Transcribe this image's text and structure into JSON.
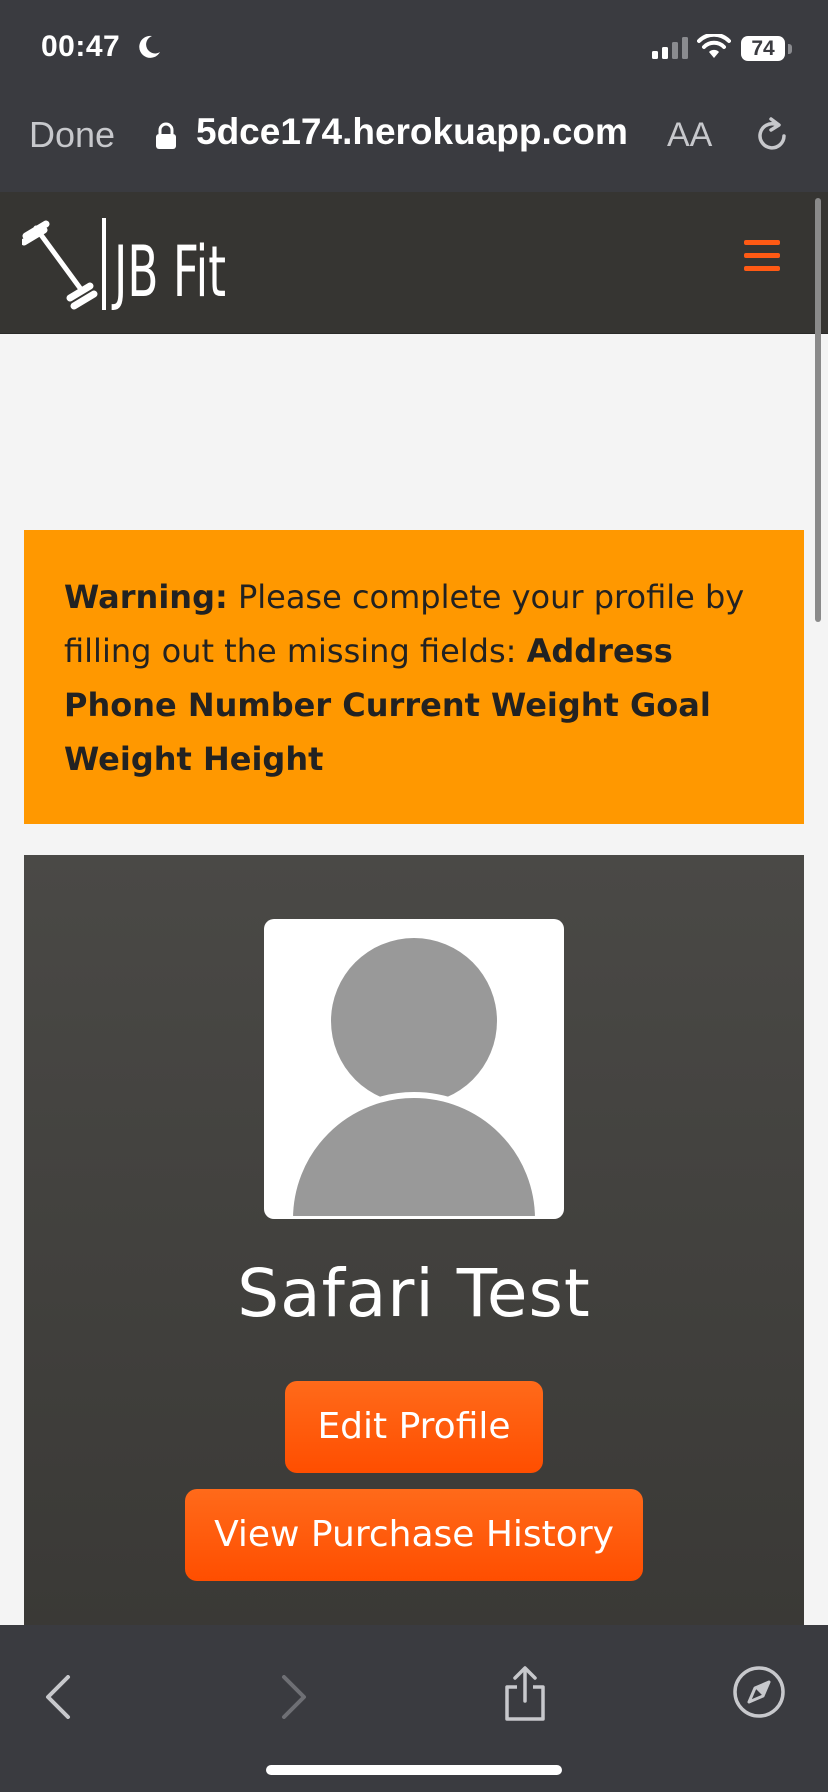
{
  "status_bar": {
    "time": "00:47",
    "battery": "74"
  },
  "url_bar": {
    "done_label": "Done",
    "url": "5dce174.herokuapp.com",
    "text_size_label": "AA"
  },
  "site": {
    "brand": "JB Fit"
  },
  "warning": {
    "label": "Warning:",
    "message": " Please complete your profile by filling out the missing fields: ",
    "missing_fields": "Address Phone Number Current Weight Goal Weight Height"
  },
  "profile": {
    "name": "Safari Test",
    "edit_button": "Edit Profile",
    "history_button": "View Purchase History"
  },
  "colors": {
    "accent": "#ff5a14",
    "warning_bg": "#ff9800",
    "chrome": "#3a3b40",
    "nav": "#363532"
  },
  "icons": [
    "moon-icon",
    "signal-icon",
    "wifi-icon",
    "battery-icon",
    "lock-icon",
    "reload-icon",
    "barbell-logo-icon",
    "menu-icon",
    "back-icon",
    "forward-icon",
    "share-icon",
    "compass-icon",
    "avatar-placeholder-icon"
  ]
}
